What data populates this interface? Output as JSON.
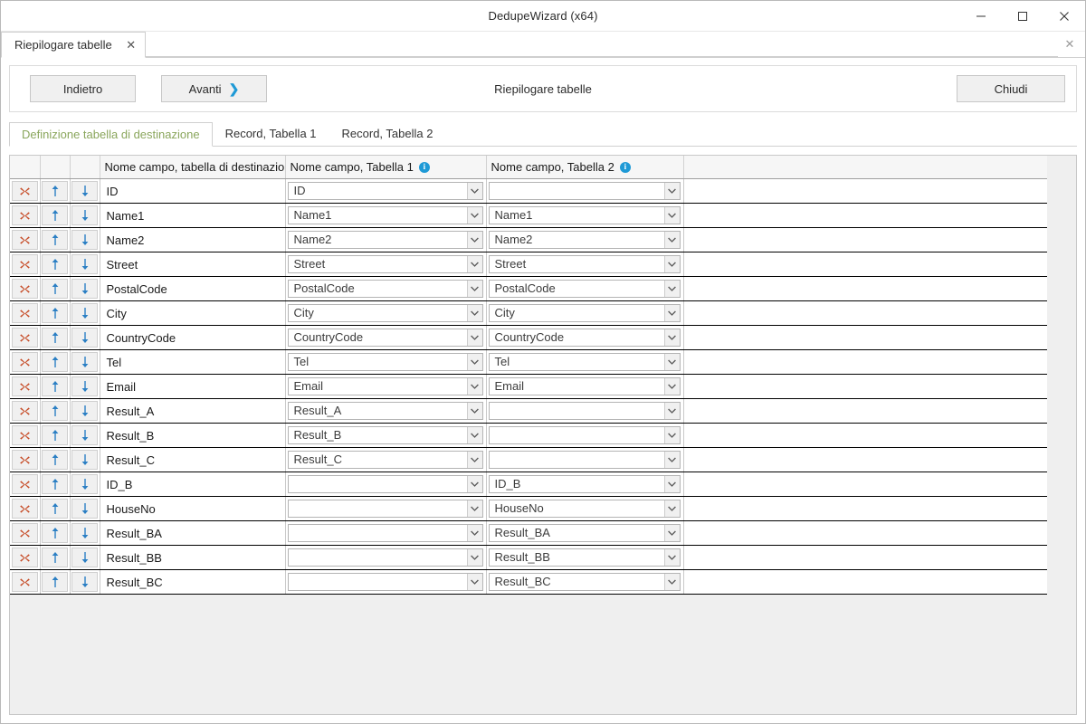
{
  "window": {
    "title": "DedupeWizard  (x64)",
    "controls": {
      "minimize": "minimize-icon",
      "maximize": "maximize-icon",
      "close": "close-icon"
    }
  },
  "doc_tab": {
    "label": "Riepilogare tabelle",
    "close_glyph": "✕",
    "strip_close_glyph": "✕"
  },
  "command_bar": {
    "back_label": "Indietro",
    "next_label": "Avanti",
    "next_chevron": "❯",
    "title": "Riepilogare tabelle",
    "close_label": "Chiudi"
  },
  "inner_tabs": [
    {
      "label": "Definizione tabella di destinazione",
      "active": true
    },
    {
      "label": "Record, Tabella 1",
      "active": false
    },
    {
      "label": "Record, Tabella 2",
      "active": false
    }
  ],
  "grid": {
    "headers": {
      "delete": "",
      "up": "",
      "down": "",
      "name": "Nome campo, tabella di destinazio",
      "table1": "Nome campo, Tabella 1",
      "table2": "Nome campo, Tabella 2",
      "pad": "",
      "info_glyph": "i"
    },
    "row_icons": {
      "delete": "delete-x-icon",
      "move_up": "arrow-up-icon",
      "move_down": "arrow-down-icon"
    },
    "rows": [
      {
        "name": "ID",
        "t1": "ID",
        "t2": ""
      },
      {
        "name": "Name1",
        "t1": "Name1",
        "t2": "Name1"
      },
      {
        "name": "Name2",
        "t1": "Name2",
        "t2": "Name2"
      },
      {
        "name": "Street",
        "t1": "Street",
        "t2": "Street"
      },
      {
        "name": "PostalCode",
        "t1": "PostalCode",
        "t2": "PostalCode"
      },
      {
        "name": "City",
        "t1": "City",
        "t2": "City"
      },
      {
        "name": "CountryCode",
        "t1": "CountryCode",
        "t2": "CountryCode"
      },
      {
        "name": "Tel",
        "t1": "Tel",
        "t2": "Tel"
      },
      {
        "name": "Email",
        "t1": "Email",
        "t2": "Email"
      },
      {
        "name": "Result_A",
        "t1": "Result_A",
        "t2": ""
      },
      {
        "name": "Result_B",
        "t1": "Result_B",
        "t2": ""
      },
      {
        "name": "Result_C",
        "t1": "Result_C",
        "t2": ""
      },
      {
        "name": "ID_B",
        "t1": "",
        "t2": "ID_B"
      },
      {
        "name": "HouseNo",
        "t1": "",
        "t2": "HouseNo"
      },
      {
        "name": "Result_BA",
        "t1": "",
        "t2": "Result_BA"
      },
      {
        "name": "Result_BB",
        "t1": "",
        "t2": "Result_BB"
      },
      {
        "name": "Result_BC",
        "t1": "",
        "t2": "Result_BC"
      }
    ]
  },
  "colors": {
    "accent_blue": "#1f9ad6",
    "delete_red": "#c64a25",
    "active_tab_text": "#8aa65c",
    "panel_gray": "#efefef"
  }
}
